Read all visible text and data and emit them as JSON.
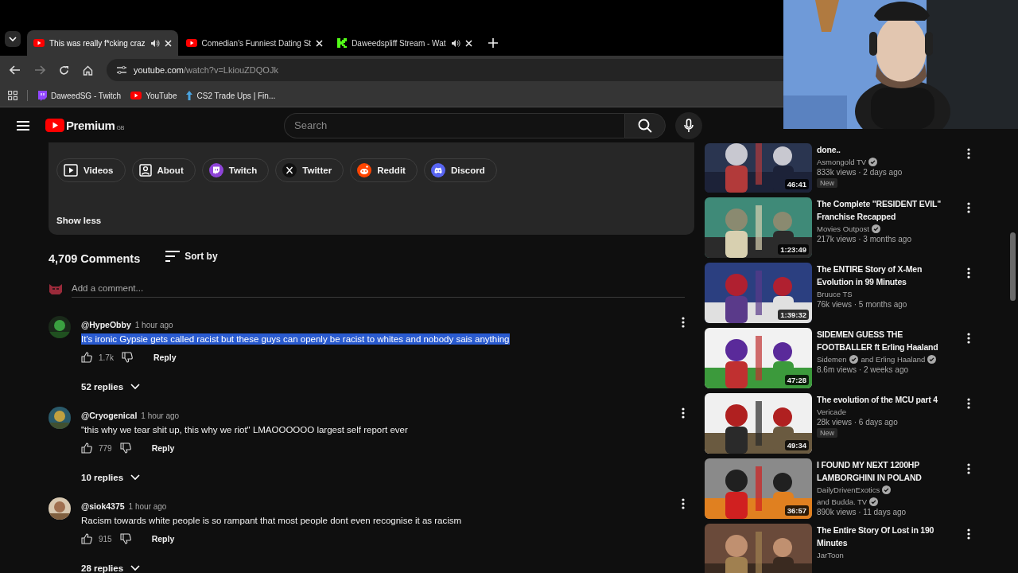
{
  "browser": {
    "tabs": [
      {
        "title": "This was really f*cking craz",
        "kind": "video",
        "audio": true,
        "selected": true
      },
      {
        "title": "Comedian's Funniest Dating St",
        "kind": "video",
        "audio": false,
        "selected": false
      },
      {
        "title": "Daweedspliff Stream - Wat",
        "kind": "stream",
        "audio": true,
        "selected": false
      }
    ],
    "url_host": "youtube.com",
    "url_path": "/watch?v=LkiouZDQOJk",
    "bookmarks": [
      {
        "label": "DaweedSG - Twitch",
        "kind": "twitch"
      },
      {
        "label": "YouTube",
        "kind": "video"
      },
      {
        "label": "CS2 Trade Ups | Fin...",
        "kind": "arrow"
      }
    ]
  },
  "masthead": {
    "logo": "Premium",
    "region": "GB",
    "search_placeholder": "Search"
  },
  "channel_card": {
    "links": [
      {
        "label": "Videos",
        "kind": "videos"
      },
      {
        "label": "About",
        "kind": "about"
      },
      {
        "label": "Twitch",
        "kind": "twitch"
      },
      {
        "label": "Twitter",
        "kind": "twitter"
      },
      {
        "label": "Reddit",
        "kind": "reddit"
      },
      {
        "label": "Discord",
        "kind": "discord"
      }
    ],
    "show_less": "Show less"
  },
  "comments_header": {
    "count": "4,709 Comments",
    "sort": "Sort by",
    "add_placeholder": "Add a comment..."
  },
  "comments": [
    {
      "author": "@HypeObby",
      "time": "1 hour ago",
      "text": "It's ironic Gypsie gets called racist but these guys can openly be racist to whites and nobody sais anything",
      "selected": true,
      "likes": "1.7k",
      "reply": "Reply",
      "replies": "52 replies"
    },
    {
      "author": "@Cryogenical",
      "time": "1 hour ago",
      "text": "\"this why we tear shit up, this why we riot\" LMAOOOOOO largest self report ever",
      "selected": false,
      "likes": "779",
      "reply": "Reply",
      "replies": "10 replies"
    },
    {
      "author": "@siok4375",
      "time": "1 hour ago",
      "text": "Racism towards white people is so rampant that most people dont even recognise it as racism",
      "selected": false,
      "likes": "915",
      "reply": "Reply",
      "replies": "28 replies"
    }
  ],
  "related": [
    {
      "title": "done..",
      "channels": [
        {
          "name": "Asmongold TV",
          "verified": true
        }
      ],
      "meta": "833k views · 2 days ago",
      "badge": "New",
      "duration": "46:41"
    },
    {
      "title": "The Complete \"RESIDENT EVIL\" Franchise Recapped",
      "channels": [
        {
          "name": "Movies Outpost",
          "verified": true
        }
      ],
      "meta": "217k views · 3 months ago",
      "duration": "1:23:49"
    },
    {
      "title": "The ENTIRE Story of X-Men Evolution in 99 Minutes",
      "channels": [
        {
          "name": "Bruuce TS",
          "verified": false
        }
      ],
      "meta": "76k views · 5 months ago",
      "duration": "1:39:32"
    },
    {
      "title": "SIDEMEN GUESS THE FOOTBALLER ft Erling Haaland",
      "channels": [
        {
          "name": "Sidemen",
          "verified": true
        },
        {
          "name": "and Erling Haaland",
          "verified": true
        }
      ],
      "meta": "8.6m views · 2 weeks ago",
      "duration": "47:28"
    },
    {
      "title": "The evolution of the MCU part 4",
      "channels": [
        {
          "name": "Vericade",
          "verified": false
        }
      ],
      "meta": "28k views · 6 days ago",
      "badge": "New",
      "duration": "49:34"
    },
    {
      "title": "I FOUND MY NEXT 1200HP LAMBORGHINI IN POLAND",
      "channels": [
        {
          "name": "DailyDrivenExotics",
          "verified": true
        },
        {
          "name": "and Budda. TV",
          "verified": true
        }
      ],
      "meta": "890k views · 11 days ago",
      "duration": "36:57"
    },
    {
      "title": "The Entire Story Of Lost in 190 Minutes",
      "channels": [
        {
          "name": "JarToon",
          "verified": false
        }
      ]
    }
  ]
}
